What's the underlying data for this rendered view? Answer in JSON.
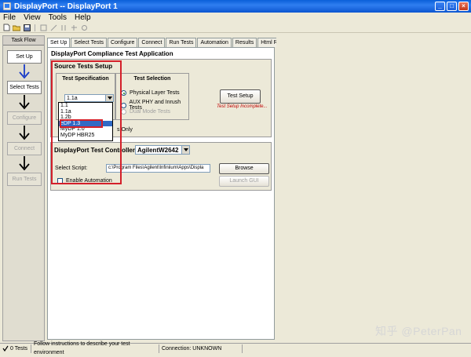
{
  "window": {
    "title": "DisplayPort -- DisplayPort 1",
    "minimize": "_",
    "maximize": "□",
    "close": "×"
  },
  "menu": [
    "File",
    "View",
    "Tools",
    "Help"
  ],
  "taskflow": {
    "header": "Task Flow",
    "steps": [
      {
        "label": "Set Up",
        "state": "enabled"
      },
      {
        "label": "Select Tests",
        "state": "enabled"
      },
      {
        "label": "Configure",
        "state": "disabled"
      },
      {
        "label": "Connect",
        "state": "disabled"
      },
      {
        "label": "Run Tests",
        "state": "disabled"
      }
    ]
  },
  "tabs": [
    "Set Up",
    "Select Tests",
    "Configure",
    "Connect",
    "Run Tests",
    "Automation",
    "Results",
    "Html Report"
  ],
  "active_tab": "Set Up",
  "main": {
    "title": "DisplayPort Compliance Test Application",
    "source": {
      "title": "Source Tests Setup",
      "spec_title": "Test Specification",
      "spec_value": "1.1a",
      "dropdown_options": [
        "1.1",
        "1.1a",
        "1.2b",
        "eDP 1.3",
        "MyDP 1.0",
        "MyDP HBR25"
      ],
      "dropdown_selected": "eDP 1.3",
      "hidden_label_fragment": "s Only",
      "selection_title": "Test Selection",
      "options": [
        {
          "label": "Physical Layer Tests",
          "checked": true,
          "disabled": false
        },
        {
          "label": "AUX PHY and Inrush Tests",
          "checked": false,
          "disabled": false
        },
        {
          "label": "Dual Mode Tests",
          "checked": false,
          "disabled": true
        }
      ],
      "setup_button": "Test Setup",
      "setup_status": "Test Setup Incomplete..."
    },
    "controller": {
      "title": "DisplayPort Test Controller",
      "controller_value": "AgilentW2642",
      "script_label": "Select Script:",
      "script_path": "c:\\Program Files\\Agilent\\Infiniium\\Apps\\Displa",
      "browse_button": "Browse",
      "launch_button": "Launch GUI",
      "automation_label": "Enable Automation"
    }
  },
  "statusbar": {
    "tests": "0 Tests",
    "message": "Follow instructions to describe your test environment",
    "connection": "Connection: UNKNOWN"
  },
  "watermark": "知乎 @PeterPan",
  "colors": {
    "title_bar": "#0a5fd8",
    "highlight": "#d4202a",
    "selection": "#316ac5",
    "arrow": "#1a3cc8"
  }
}
